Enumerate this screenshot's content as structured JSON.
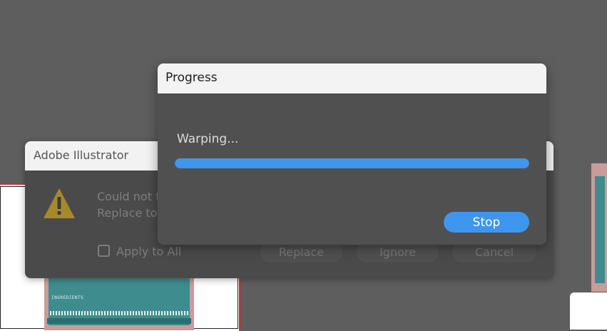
{
  "background": {
    "label_text": "INGREDIENTS"
  },
  "illustrator_dialog": {
    "title": "Adobe Illustrator",
    "message_line1": "Could not f",
    "message_line2": "Replace to",
    "apply_to_all_label": "Apply to All",
    "apply_to_all_checked": false,
    "buttons": {
      "replace": "Replace",
      "ignore": "Ignore",
      "cancel": "Cancel"
    },
    "icon": "warning-icon"
  },
  "progress_dialog": {
    "title": "Progress",
    "status": "Warping...",
    "progress_fraction": 1.0,
    "stop_label": "Stop",
    "accent_color": "#3e96ee"
  }
}
